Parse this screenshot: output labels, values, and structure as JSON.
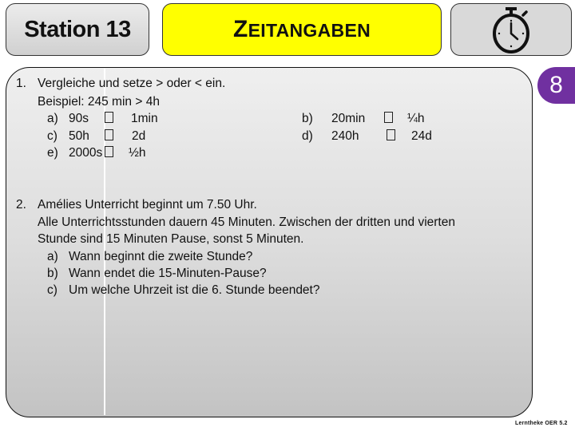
{
  "header": {
    "station_label": "Station 13",
    "title_first_letter": "Z",
    "title_rest": "EITANGABEN",
    "title_bg_color": "#ffff00",
    "clock_icon": "stopwatch-icon"
  },
  "badge": {
    "value": "8",
    "color": "#7030a0"
  },
  "task1": {
    "number": "1.",
    "instruction": "Vergleiche und setze > oder < ein.",
    "example": "Beispiel: 245 min > 4h",
    "items": [
      {
        "label": "a)",
        "left": "90s",
        "right": "1min"
      },
      {
        "label": "b)",
        "left": "20min",
        "right": "¼h"
      },
      {
        "label": "c)",
        "left": "50h",
        "right": "2d"
      },
      {
        "label": "d)",
        "left": "240h",
        "right": "24d"
      },
      {
        "label": "e)",
        "left": "2000s",
        "right": "½h"
      }
    ]
  },
  "task2": {
    "number": "2.",
    "line1": "Amélies Unterricht beginnt um 7.50 Uhr.",
    "line2": "Alle Unterrichtsstunden dauern 45 Minuten. Zwischen der dritten und vierten",
    "line3": "Stunde sind 15 Minuten Pause, sonst 5 Minuten.",
    "questions": [
      {
        "label": "a)",
        "text": "Wann beginnt die zweite Stunde?"
      },
      {
        "label": "b)",
        "text": "Wann endet die 15-Minuten-Pause?"
      },
      {
        "label": "c)",
        "text": "Um welche Uhrzeit ist die 6. Stunde beendet?"
      }
    ]
  },
  "footer": {
    "text": "Lerntheke OER 5.2"
  }
}
